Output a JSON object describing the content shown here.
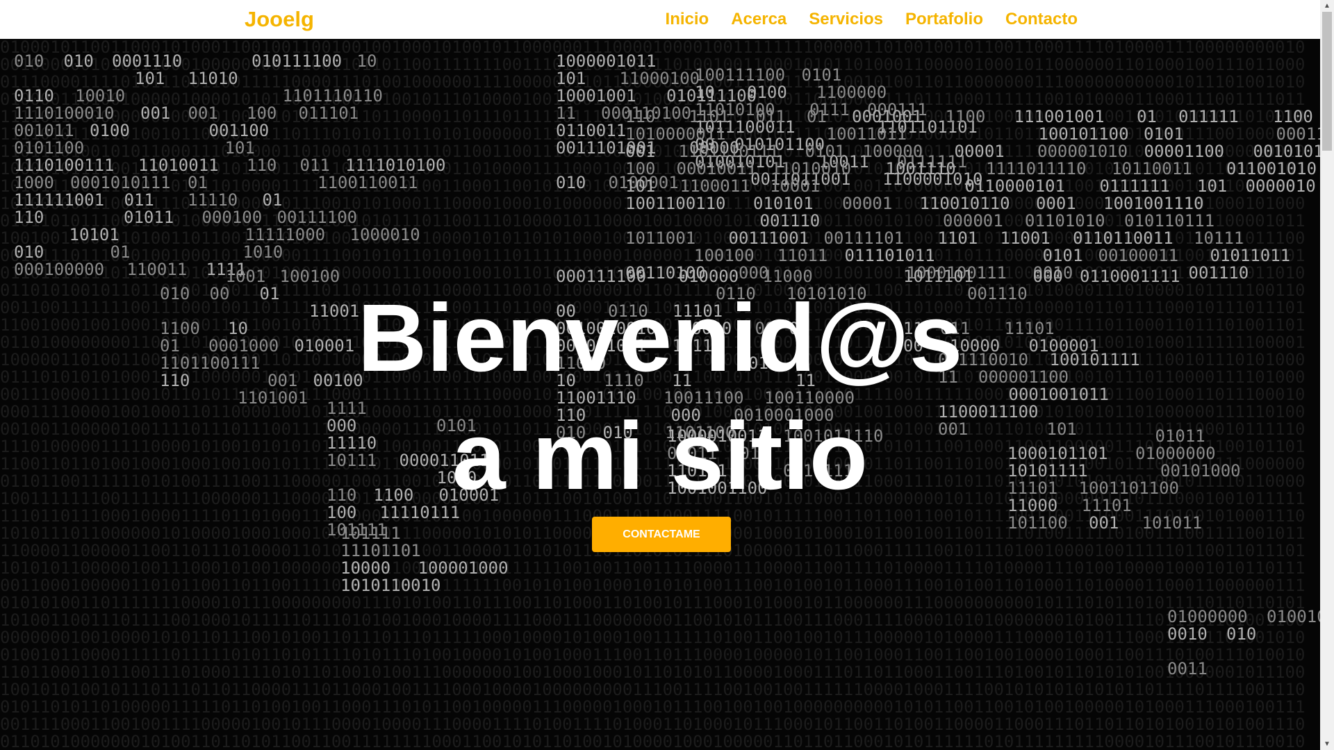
{
  "navbar": {
    "brand": "Jooelg",
    "links": [
      "Inicio",
      "Acerca",
      "Servicios",
      "Portafolio",
      "Contacto"
    ]
  },
  "hero": {
    "title_line1": "Bienvenid@s",
    "title_line2": "a mi sitio",
    "cta_label": "CONTACTAME"
  },
  "scrollbar": {
    "up_icon": "chevron-up-icon",
    "down_icon": "chevron-down-icon"
  },
  "colors": {
    "accent": "#f5b400",
    "button": "#ffae00",
    "hero_bg": "#050505",
    "navbar_bg": "#ffffff",
    "title": "#ffffff"
  }
}
